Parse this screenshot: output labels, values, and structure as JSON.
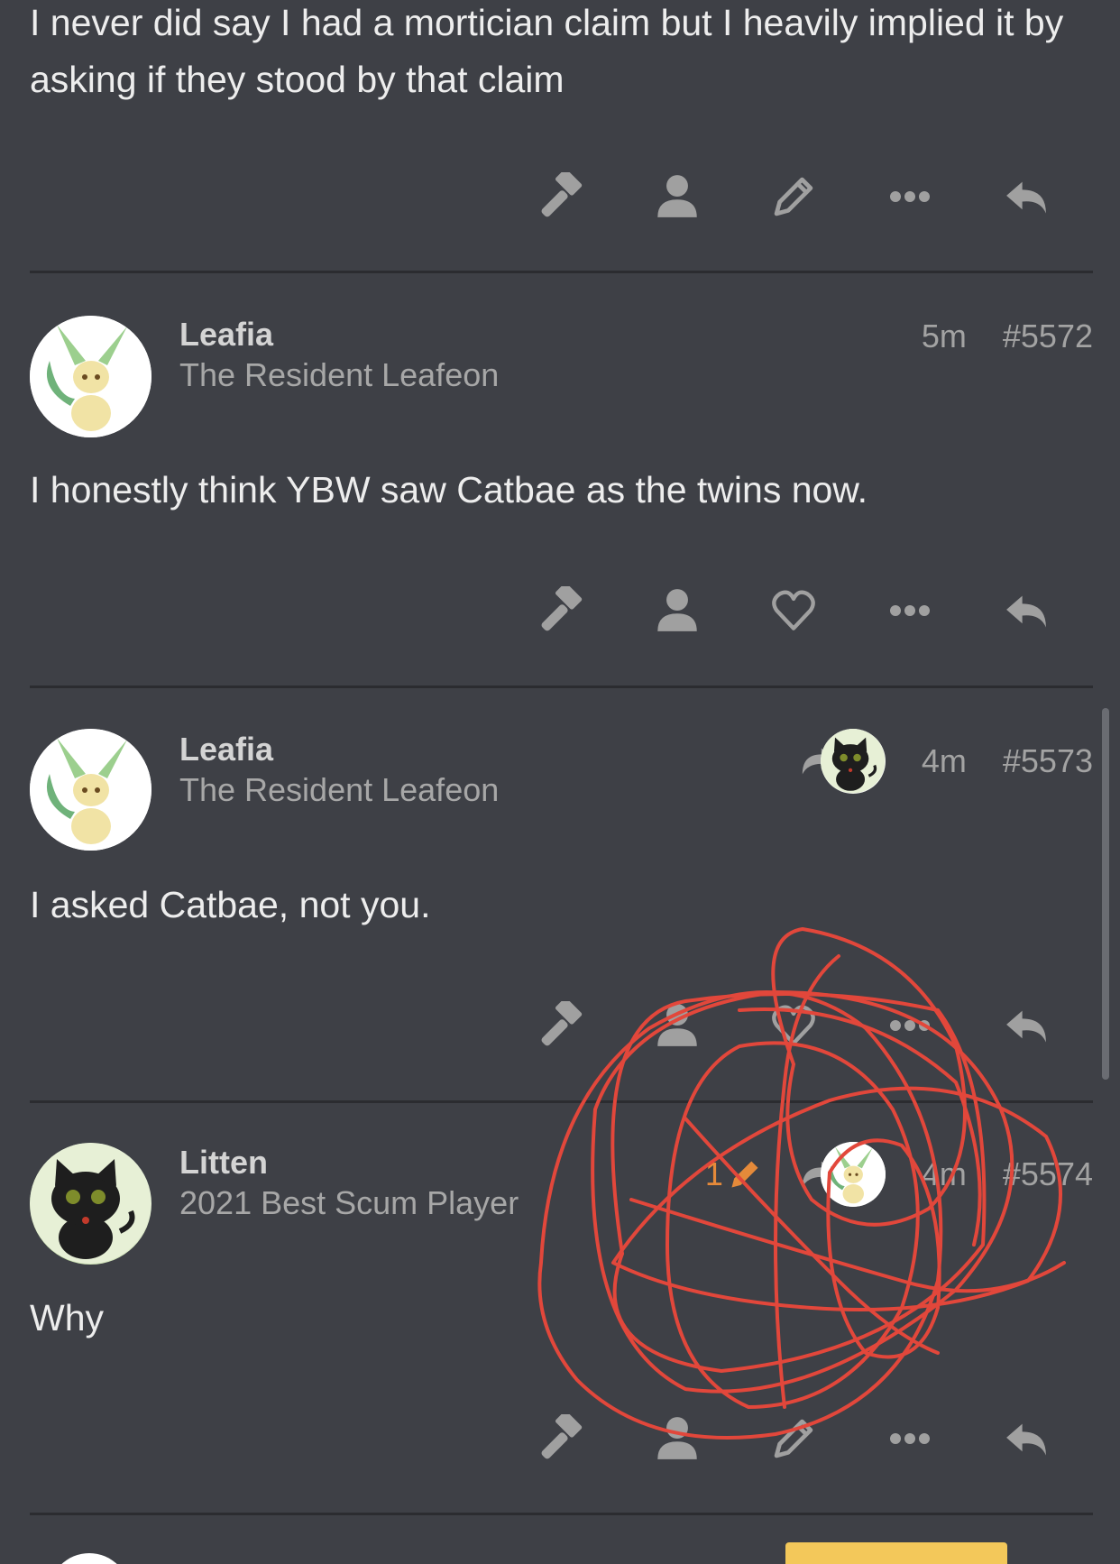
{
  "posts": [
    {
      "text": "I never did say I had a mortician claim but I heavily implied it by asking if they stood by that claim"
    },
    {
      "username": "Leafia",
      "user_title": "The Resident Leafeon",
      "time": "5m",
      "post_number": "#5572",
      "text": "I honestly think YBW saw Catbae as the twins now."
    },
    {
      "username": "Leafia",
      "user_title": "The Resident Leafeon",
      "time": "4m",
      "post_number": "#5573",
      "text": "I asked Catbae, not you."
    },
    {
      "username": "Litten",
      "user_title": "2021 Best Scum Player",
      "edit_count": "1",
      "time": "4m",
      "post_number": "#5574",
      "text": "Why"
    }
  ],
  "icons": {
    "gavel": "gavel-icon",
    "user": "user-icon",
    "edit": "pencil-icon",
    "like": "heart-icon",
    "more": "ellipsis-icon",
    "reply": "reply-icon",
    "reply_to": "share-arrow-icon"
  },
  "colors": {
    "background": "#3e4046",
    "divider": "#2b2c30",
    "icon": "#a0a0a0",
    "edit_accent": "#e58a3a",
    "scribble": "#e2473b"
  }
}
